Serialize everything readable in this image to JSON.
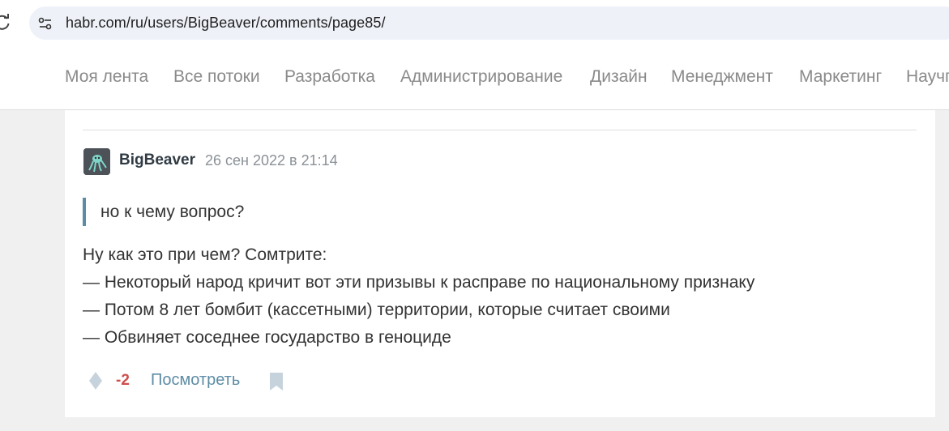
{
  "browser": {
    "url": "habr.com/ru/users/BigBeaver/comments/page85/"
  },
  "nav": {
    "items": [
      {
        "label": "Моя лента"
      },
      {
        "label": "Все потоки"
      },
      {
        "label": "Разработка"
      },
      {
        "label": "Администрирование"
      },
      {
        "label": "Дизайн"
      },
      {
        "label": "Менеджмент"
      },
      {
        "label": "Маркетинг"
      },
      {
        "label": "Научп"
      }
    ]
  },
  "comment": {
    "author": "BigBeaver",
    "timestamp": "26 сен 2022 в 21:14",
    "quote": "но к чему вопрос?",
    "body_lines": [
      "Ну как это при чем? Сомтрите:",
      "— Некоторый народ кричит вот эти призывы к расправе по национальному признаку",
      "— Потом 8 лет бомбит (кассетными) территории, которые считает своими",
      "— Обвиняет соседнее государство в геноциде"
    ],
    "score": "-2",
    "view_label": "Посмотреть"
  },
  "colors": {
    "link": "#5e8ca6",
    "negative_score": "#d04e4e",
    "nav_text": "#8a8a8a",
    "quote_bar": "#5e8ca6"
  },
  "icons": {
    "reload": "reload-icon",
    "site_info": "site-info-icon",
    "vote": "vote-icon",
    "bookmark": "bookmark-icon"
  }
}
